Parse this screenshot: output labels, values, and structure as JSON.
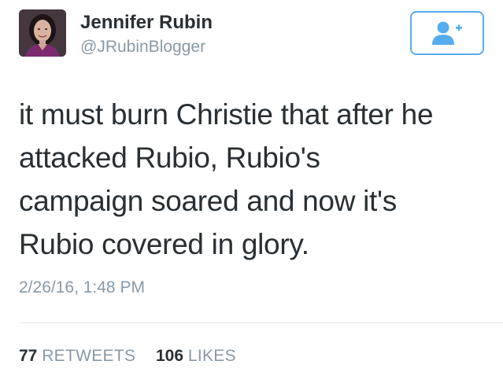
{
  "user": {
    "display_name": "Jennifer Rubin",
    "handle": "@JRubinBlogger"
  },
  "follow_button": {
    "icon": "add-user-icon",
    "color": "#55acee"
  },
  "tweet": {
    "lines": [
      "it must burn Christie that after he",
      "attacked Rubio, Rubio's",
      "campaign soared and now it's",
      "Rubio covered in glory."
    ],
    "timestamp": "2/26/16, 1:48 PM"
  },
  "stats": {
    "retweets_count": "77",
    "retweets_label": "RETWEETS",
    "likes_count": "106",
    "likes_label": "LIKES"
  },
  "colors": {
    "text": "#292f33",
    "secondary": "#8899a6",
    "accent": "#55acee",
    "divider": "#e1e8ed"
  }
}
